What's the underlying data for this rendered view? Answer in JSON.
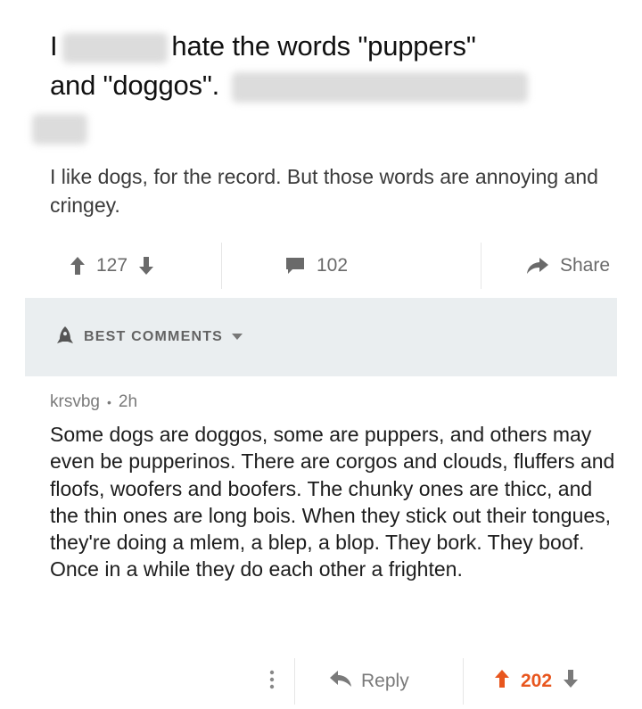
{
  "post": {
    "title_prefix": "I",
    "title_main": "hate the words \"puppers\"",
    "title_line2": "and \"doggos\".",
    "body": "I like dogs, for the record. But those words are annoying and cringey."
  },
  "post_actions": {
    "upvotes": "127",
    "comments": "102",
    "share_label": "Share"
  },
  "comments_header": {
    "label": "BEST COMMENTS"
  },
  "comment": {
    "author": "krsvbg",
    "separator": "•",
    "age": "2h",
    "text": "Some dogs are doggos, some are puppers, and others may even be pupperinos. There are corgos and clouds, fluffers and floofs, woofers and boofers. The chunky ones are thicc, and the thin ones are long bois. When they stick out their tongues, they're doing a mlem, a blep, a blop. They bork. They boof. Once in a while they do each other a frighten.",
    "reply_label": "Reply",
    "score": "202"
  },
  "colors": {
    "accent_upvote": "#e8561e",
    "muted_icon": "#6a6a6a",
    "header_bar": "#eaeef0"
  }
}
